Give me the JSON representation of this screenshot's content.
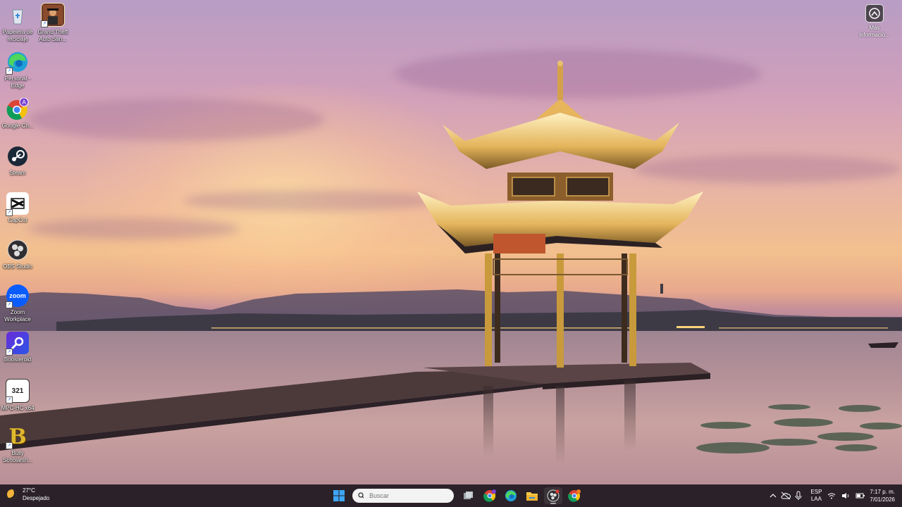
{
  "desktop": {
    "icons": [
      {
        "label": "Papelera de\nreciclaje",
        "icon": "recycle-bin-icon"
      },
      {
        "label": "Grand Theft\nAuto San...",
        "icon": "gta-san-andreas-icon"
      },
      {
        "label": "Personal -\nEdge",
        "icon": "edge-icon"
      },
      {
        "label": "Google Ch...",
        "icon": "chrome-icon"
      },
      {
        "label": "Steam",
        "icon": "steam-icon"
      },
      {
        "label": "CapCut",
        "icon": "capcut-icon"
      },
      {
        "label": "OBS Studio",
        "icon": "obs-icon"
      },
      {
        "label": "Zoom\nWorkplace",
        "icon": "zoom-icon",
        "badge": "zoom"
      },
      {
        "label": "Boosteroid",
        "icon": "boosteroid-icon"
      },
      {
        "label": "MPC-HC x64",
        "icon": "mpc-hc-icon",
        "badge": "321"
      },
      {
        "label": "Bully\nScholarsh...",
        "icon": "bully-icon",
        "badge": "B"
      }
    ],
    "info_widget": {
      "label": "Más\ninformació...",
      "icon": "camera-info-icon"
    }
  },
  "taskbar": {
    "weather": {
      "temp": "27°C",
      "condition": "Despejado",
      "icon": "moon-icon"
    },
    "search": {
      "placeholder": "Buscar",
      "icon": "search-icon"
    },
    "apps": [
      {
        "name": "Start",
        "icon": "windows-start-icon"
      },
      {
        "name": "Task View",
        "icon": "task-view-icon"
      },
      {
        "name": "Google Chrome profile",
        "icon": "chrome-icon"
      },
      {
        "name": "Microsoft Edge",
        "icon": "edge-icon"
      },
      {
        "name": "File Explorer",
        "icon": "folder-icon"
      },
      {
        "name": "OBS Studio",
        "icon": "obs-icon"
      },
      {
        "name": "Google Chrome",
        "icon": "chrome-icon"
      }
    ],
    "tray": {
      "language_top": "ESP",
      "language_bottom": "LAA",
      "time": "7:17 p. m.",
      "date": "7/01/2026"
    }
  },
  "colors": {
    "taskbar_bg": "#2a2228",
    "accent_blue": "#0a64d6"
  }
}
